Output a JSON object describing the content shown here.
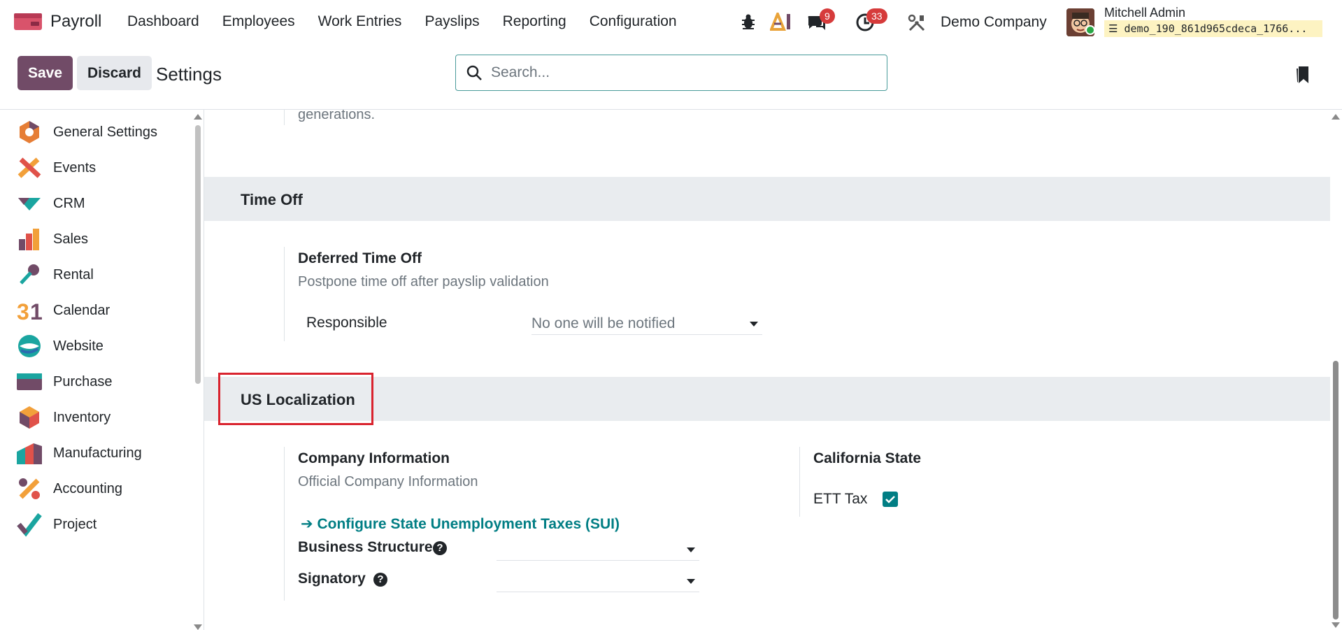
{
  "navbar": {
    "app_name": "Payroll",
    "menu": [
      "Dashboard",
      "Employees",
      "Work Entries",
      "Payslips",
      "Reporting",
      "Configuration"
    ],
    "messages_badge": "9",
    "activities_badge": "33",
    "company": "Demo Company",
    "user_name": "Mitchell Admin",
    "database": "demo_190_861d965cdeca_1766..."
  },
  "control": {
    "save_label": "Save",
    "discard_label": "Discard",
    "breadcrumb": "Settings",
    "search_placeholder": "Search..."
  },
  "sidebar": {
    "items": [
      {
        "label": "General Settings",
        "icon": "general-settings-icon"
      },
      {
        "label": "Events",
        "icon": "events-icon"
      },
      {
        "label": "CRM",
        "icon": "crm-icon"
      },
      {
        "label": "Sales",
        "icon": "sales-icon"
      },
      {
        "label": "Rental",
        "icon": "rental-icon"
      },
      {
        "label": "Calendar",
        "icon": "calendar-icon"
      },
      {
        "label": "Website",
        "icon": "website-icon"
      },
      {
        "label": "Purchase",
        "icon": "purchase-icon"
      },
      {
        "label": "Inventory",
        "icon": "inventory-icon"
      },
      {
        "label": "Manufacturing",
        "icon": "manufacturing-icon"
      },
      {
        "label": "Accounting",
        "icon": "accounting-icon"
      },
      {
        "label": "Project",
        "icon": "project-icon"
      }
    ]
  },
  "content": {
    "top_fragment": "generations.",
    "time_off": {
      "section_title": "Time Off",
      "deferred_title": "Deferred Time Off",
      "deferred_desc": "Postpone time off after payslip validation",
      "responsible_label": "Responsible",
      "responsible_value": "No one will be notified"
    },
    "us_localization": {
      "section_title": "US Localization",
      "company_info_title": "Company Information",
      "company_info_desc": "Official Company Information",
      "sui_link": "Configure State Unemployment Taxes (SUI)",
      "business_structure_label": "Business Structure",
      "signatory_label": "Signatory",
      "california_title": "California State",
      "ett_tax_label": "ETT Tax",
      "ett_tax_checked": true
    }
  },
  "colors": {
    "brand": "#714b67",
    "accent": "#017e84",
    "highlight": "#d9232e",
    "badge": "#d63b3b"
  }
}
